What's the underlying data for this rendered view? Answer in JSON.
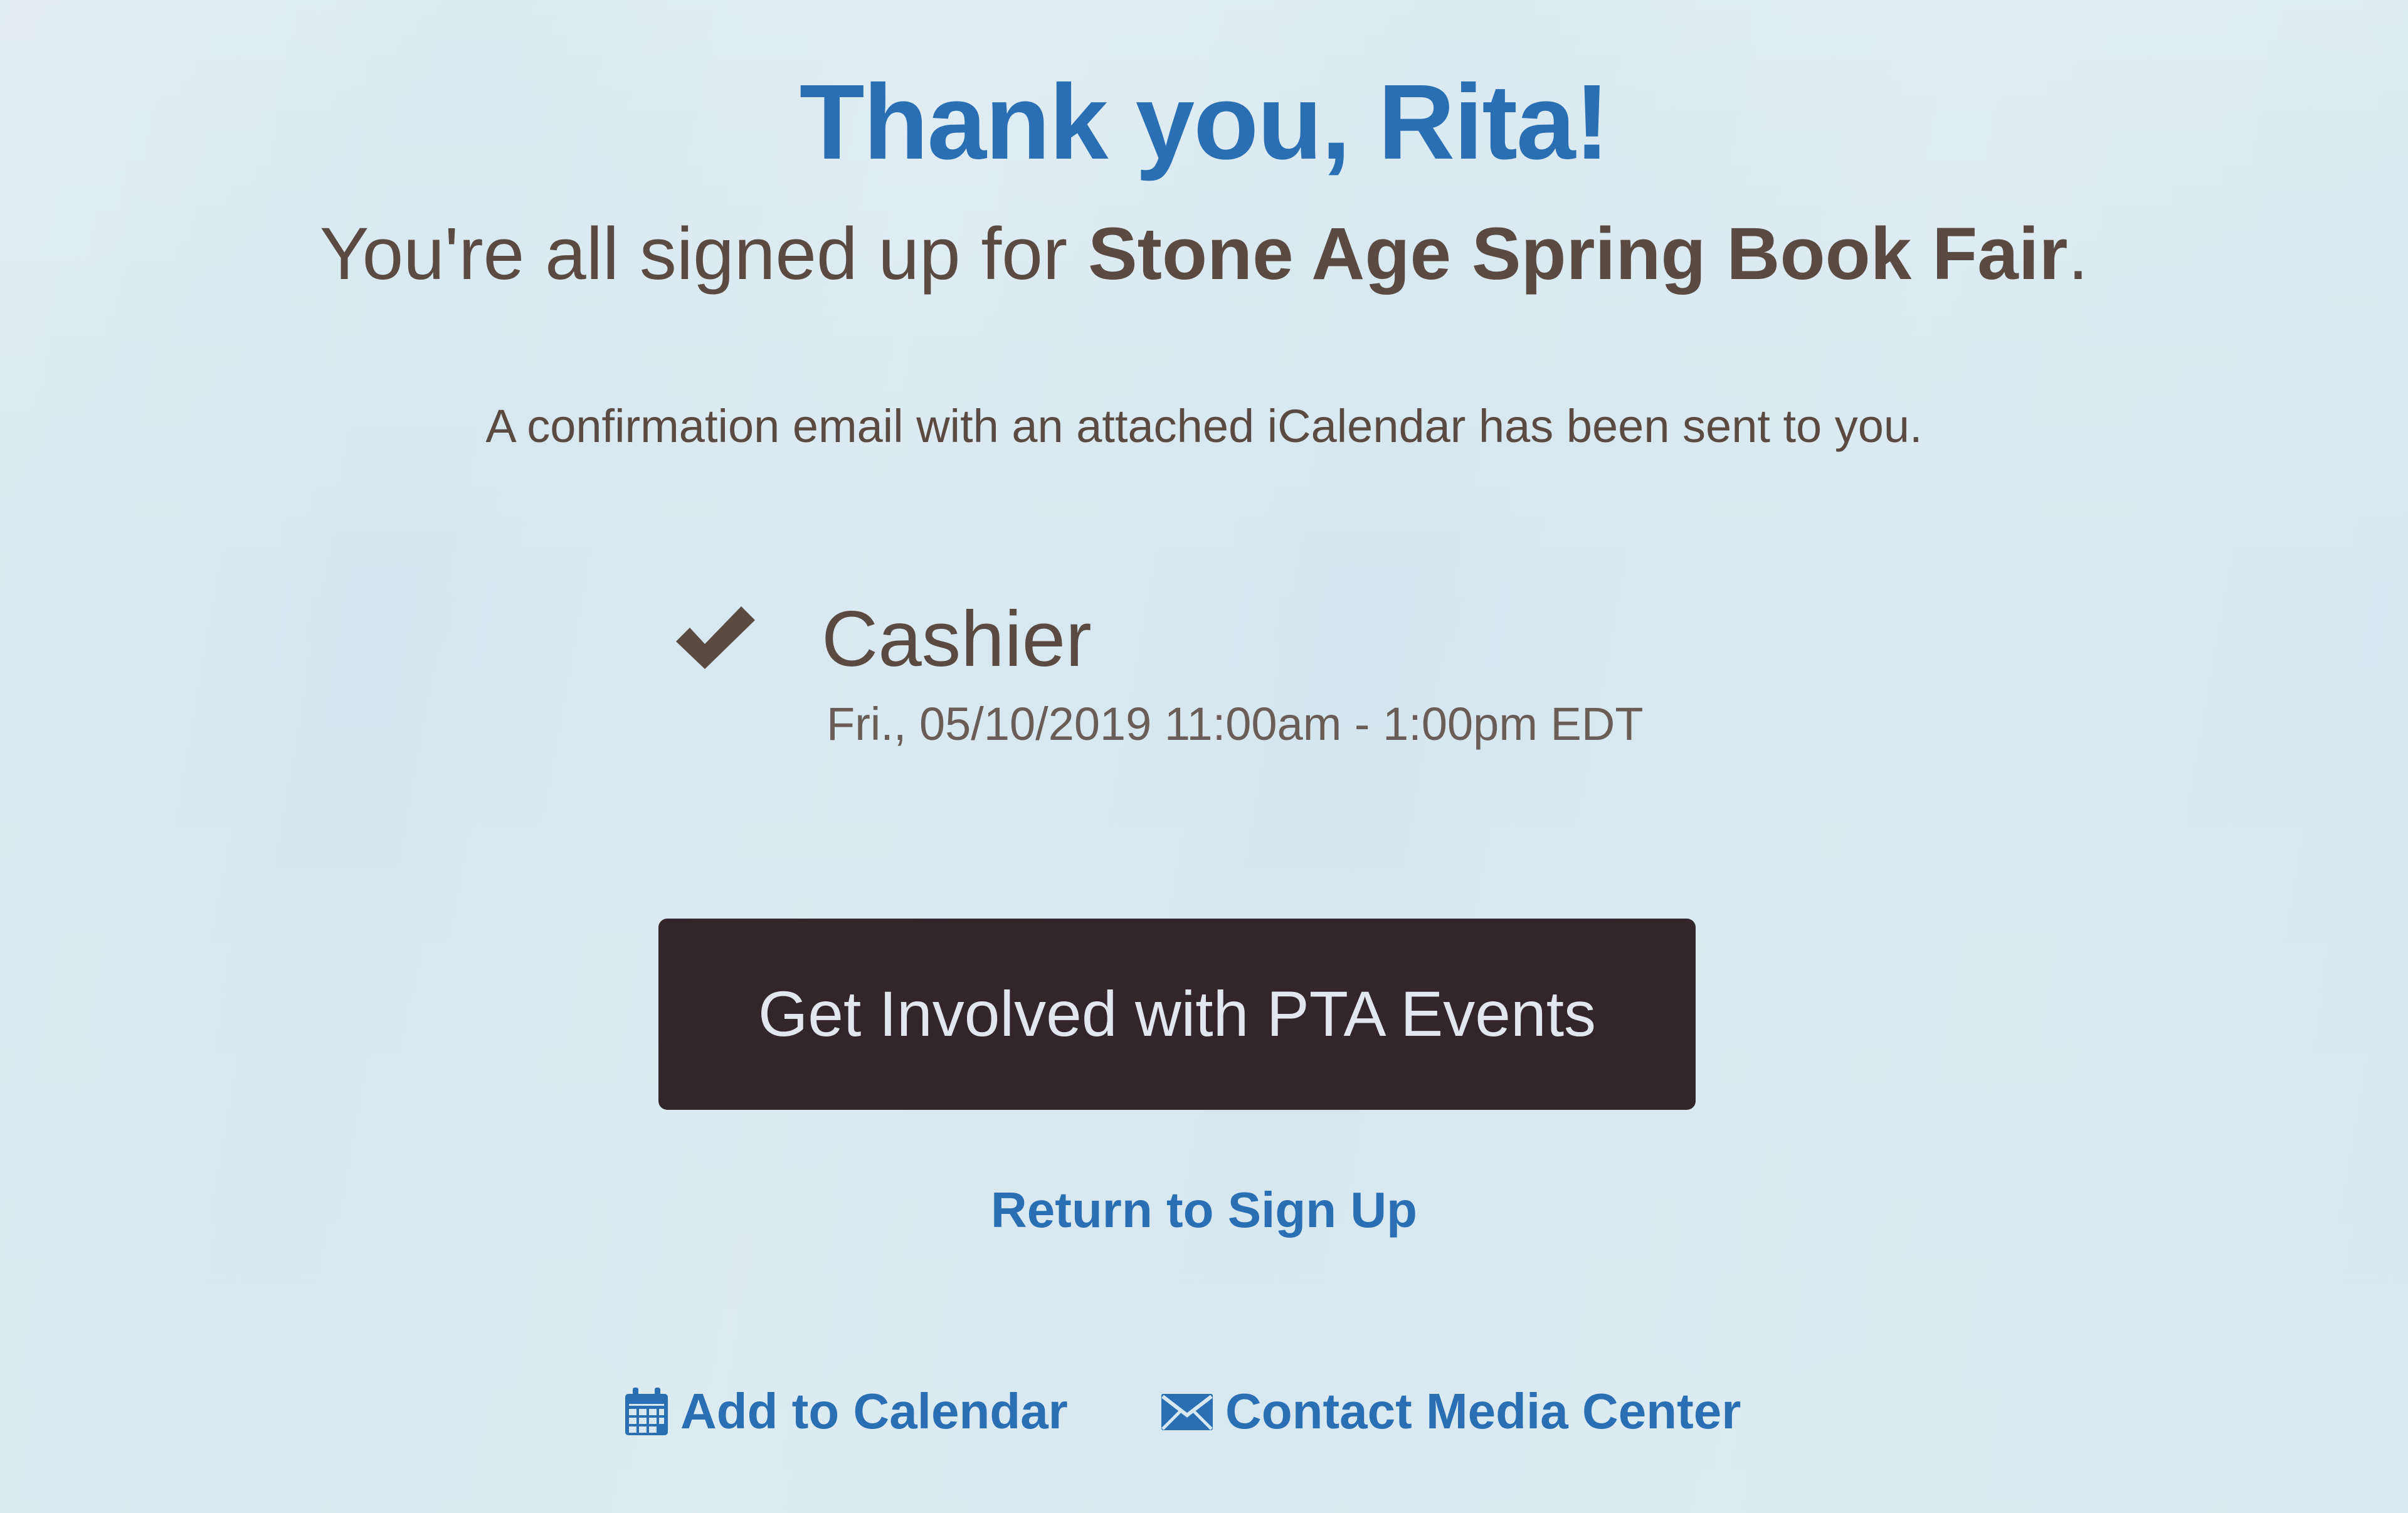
{
  "heading": {
    "text": "Thank you, Rita!"
  },
  "subheading": {
    "prefix": "You're all signed up for ",
    "event_name": "Stone Age Spring Book Fair",
    "suffix": "."
  },
  "confirmation": {
    "text": "A confirmation email with an attached iCalendar has been sent to you."
  },
  "slot": {
    "icon": "check-icon",
    "title": "Cashier",
    "time": "Fri., 05/10/2019 11:00am - 1:00pm EDT"
  },
  "cta": {
    "label": "Get Involved with PTA Events"
  },
  "return_link": {
    "label": "Return to Sign Up"
  },
  "footer_links": {
    "calendar": {
      "icon": "calendar-icon",
      "label": "Add to Calendar"
    },
    "contact": {
      "icon": "envelope-icon",
      "label": "Contact Media Center"
    }
  },
  "colors": {
    "link_blue": "#2a6fb4",
    "text_brown": "#5b4a42",
    "button_dark": "#33262a"
  }
}
